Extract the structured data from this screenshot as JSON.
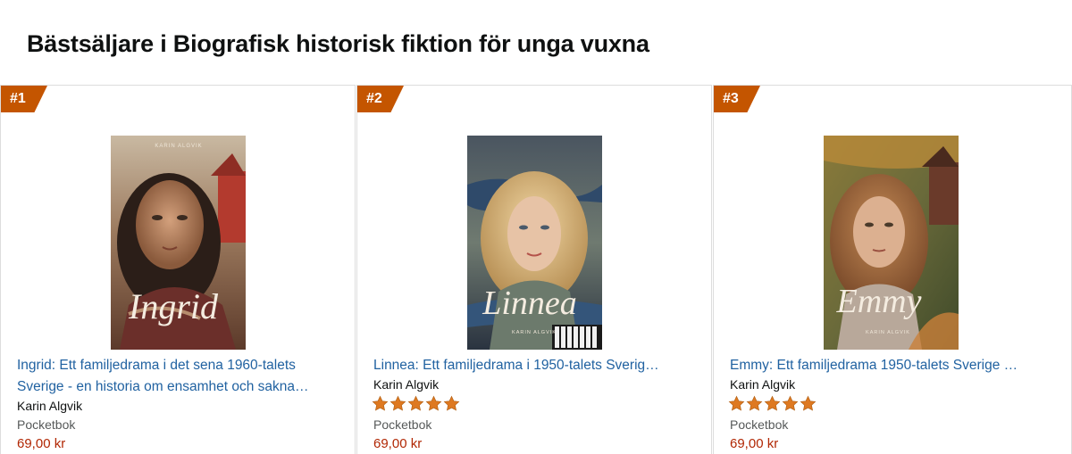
{
  "page": {
    "heading": "Bästsäljare i Biografisk historisk fiktion för unga vuxna"
  },
  "colors": {
    "badge": "#c45500",
    "link": "#2162a1",
    "price": "#b12704",
    "star": "#de7921"
  },
  "products": [
    {
      "rank": "#1",
      "cover_author": "KARIN ALGVIK",
      "cover_title": "Ingrid",
      "title_line1": "Ingrid: Ett familjedrama i det sena 1960-talets",
      "title_line2": "Sverige - en historia om ensamhet och sakna…",
      "author": "Karin Algvik",
      "rating_stars": 0,
      "format": "Pocketbok",
      "price": "69,00 kr"
    },
    {
      "rank": "#2",
      "cover_author": "KARIN ALGVIK",
      "cover_title": "Linnea",
      "title_line1": "Linnea: Ett familjedrama i 1950-talets Sverig…",
      "title_line2": "",
      "author": "Karin Algvik",
      "rating_stars": 5,
      "format": "Pocketbok",
      "price": "69,00 kr"
    },
    {
      "rank": "#3",
      "cover_author": "KARIN ALGVIK",
      "cover_title": "Emmy",
      "title_line1": "Emmy: Ett familjedrama 1950-talets Sverige …",
      "title_line2": "",
      "author": "Karin Algvik",
      "rating_stars": 5,
      "format": "Pocketbok",
      "price": "69,00 kr"
    }
  ]
}
